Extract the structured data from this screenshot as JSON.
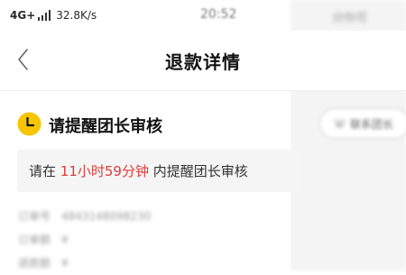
{
  "status_bar": {
    "network": "4G+",
    "speed": "32.8K/s",
    "time": "20:52"
  },
  "header": {
    "title": "退款详情"
  },
  "right_panel": {
    "top_text": "分你可",
    "contact_button": "联系团长"
  },
  "refund": {
    "status_title": "请提醒团长审核",
    "notice_prefix": "请在 ",
    "notice_deadline": "11小时59分钟",
    "notice_suffix": " 内提醒团长审核"
  },
  "order_info": [
    {
      "label": "订单号",
      "value": "4843148098230"
    },
    {
      "label": "订单额",
      "value": "¥"
    },
    {
      "label": "退款额",
      "value": "¥"
    }
  ],
  "colors": {
    "accent_yellow": "#f7c400",
    "deadline_red": "#e03b3b"
  },
  "icons": {
    "back": "chevron-left-icon",
    "status": "clock-icon",
    "contact": "phone-icon"
  }
}
